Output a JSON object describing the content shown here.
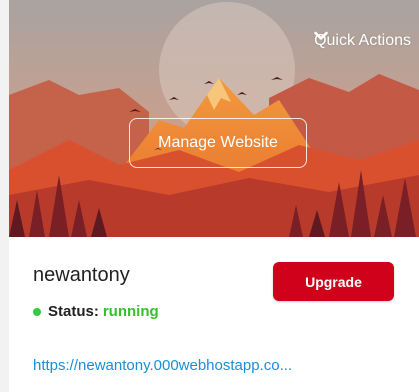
{
  "banner": {
    "quick_actions_label": "Quick Actions",
    "manage_label": "Manage Website"
  },
  "site": {
    "name": "newantony",
    "upgrade_label": "Upgrade",
    "status_label": "Status:",
    "status_value": "running",
    "url": "https://newantony.000webhostapp.co..."
  },
  "colors": {
    "upgrade": "#d0021b",
    "status_running": "#35c12a",
    "link": "#1a8fd6"
  },
  "icons": {
    "quick_actions": "chevron-down-icon",
    "status": "status-dot-icon"
  }
}
